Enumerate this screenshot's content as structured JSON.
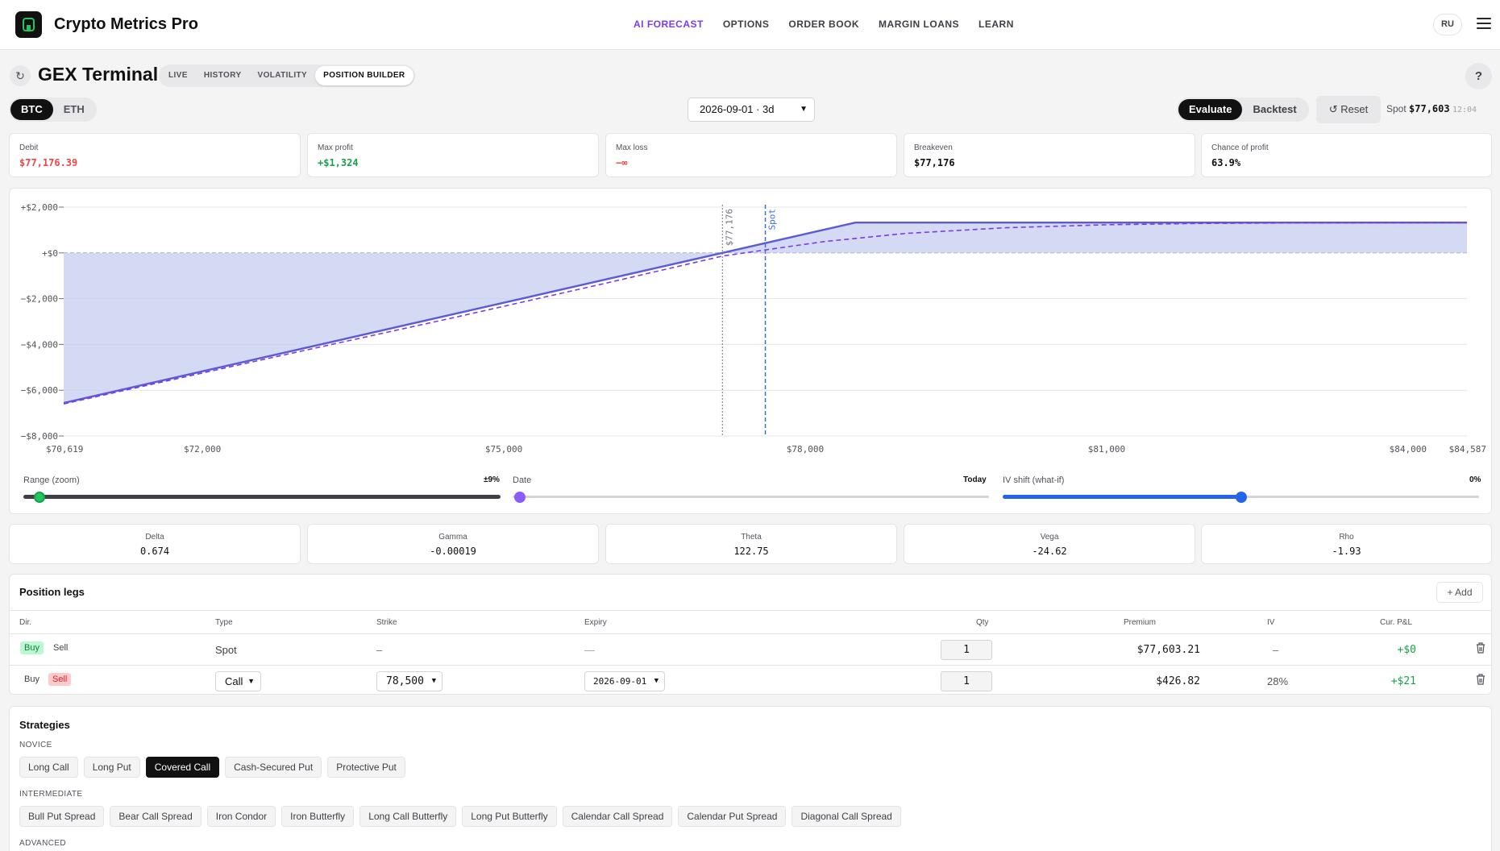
{
  "app": {
    "title": "Crypto Metrics Pro",
    "logo_icon": "chart-logo-icon"
  },
  "nav": [
    {
      "label": "AI FORECAST",
      "active": true
    },
    {
      "label": "OPTIONS",
      "active": false
    },
    {
      "label": "ORDER BOOK",
      "active": false
    },
    {
      "label": "MARGIN LOANS",
      "active": false
    },
    {
      "label": "LEARN",
      "active": false
    }
  ],
  "lang": "RU",
  "page": {
    "title": "GEX Terminal",
    "refresh_icon": "↻",
    "help_icon": "?",
    "subtabs": [
      {
        "label": "LIVE",
        "active": false
      },
      {
        "label": "HISTORY",
        "active": false
      },
      {
        "label": "VOLATILITY",
        "active": false
      },
      {
        "label": "POSITION BUILDER",
        "active": true
      }
    ]
  },
  "controls": {
    "assets": [
      {
        "label": "BTC",
        "active": true
      },
      {
        "label": "ETH",
        "active": false
      }
    ],
    "expiry": "2026-09-01 · 3d",
    "modes": [
      {
        "label": "Evaluate",
        "active": true
      },
      {
        "label": "Backtest",
        "active": false
      }
    ],
    "reset_label": "Reset",
    "spot_label": "Spot",
    "spot_value": "$77,603",
    "spot_time": "12:04"
  },
  "stats": [
    {
      "label": "Debit",
      "value": "$77,176.39",
      "tone": "red"
    },
    {
      "label": "Max profit",
      "value": "+$1,324",
      "tone": "green"
    },
    {
      "label": "Max loss",
      "value": "−∞",
      "tone": "red"
    },
    {
      "label": "Breakeven",
      "value": "$77,176",
      "tone": "dark"
    },
    {
      "label": "Chance of profit",
      "value": "63.9%",
      "tone": "dark"
    }
  ],
  "chart_data": {
    "type": "area",
    "xlim": [
      70619,
      84587
    ],
    "ylim": [
      -8000,
      2000
    ],
    "x_ticks": [
      {
        "value": 70619,
        "label": "$70,619"
      },
      {
        "value": 72000,
        "label": "$72,000"
      },
      {
        "value": 75000,
        "label": "$75,000"
      },
      {
        "value": 78000,
        "label": "$78,000"
      },
      {
        "value": 81000,
        "label": "$81,000"
      },
      {
        "value": 84000,
        "label": "$84,000"
      },
      {
        "value": 84587,
        "label": "$84,587"
      }
    ],
    "y_ticks": [
      {
        "value": 2000,
        "label": "+$2,000"
      },
      {
        "value": 0,
        "label": "+$0"
      },
      {
        "value": -2000,
        "label": "−$2,000"
      },
      {
        "value": -4000,
        "label": "−$4,000"
      },
      {
        "value": -6000,
        "label": "−$6,000"
      },
      {
        "value": -8000,
        "label": "−$8,000"
      }
    ],
    "series": [
      {
        "style": "solid",
        "color": "#5b5bd6",
        "points": [
          [
            70619,
            -6557
          ],
          [
            77176,
            0
          ],
          [
            78500,
            1324
          ],
          [
            84587,
            1324
          ]
        ]
      },
      {
        "style": "dashed",
        "color": "#7c3aed",
        "points": [
          [
            70619,
            -6600
          ],
          [
            72500,
            -4760
          ],
          [
            74500,
            -2830
          ],
          [
            76000,
            -1340
          ],
          [
            77176,
            -140
          ],
          [
            77603,
            130
          ],
          [
            78200,
            500
          ],
          [
            79000,
            850
          ],
          [
            80000,
            1100
          ],
          [
            81000,
            1230
          ],
          [
            82000,
            1290
          ],
          [
            83000,
            1310
          ],
          [
            84587,
            1320
          ]
        ]
      }
    ],
    "markers": [
      {
        "x": 77176,
        "label": "$77,176",
        "color": "#71717a",
        "style": "dotted"
      },
      {
        "x": 77603,
        "label": "Spot",
        "color": "#3b6fd6",
        "style": "dashed"
      }
    ],
    "fill_color": "#c7cdf0",
    "grid": true
  },
  "sliders": [
    {
      "label": "Range (zoom)",
      "value": "±9%",
      "fraction": 0.02
    },
    {
      "label": "Date",
      "value": "Today",
      "fraction": 0.0
    },
    {
      "label": "IV shift (what-if)",
      "value": "0%",
      "fraction": 0.5
    }
  ],
  "greeks": [
    {
      "label": "Delta",
      "value": "0.674"
    },
    {
      "label": "Gamma",
      "value": "-0.00019"
    },
    {
      "label": "Theta",
      "value": "122.75"
    },
    {
      "label": "Vega",
      "value": "-24.62"
    },
    {
      "label": "Rho",
      "value": "-1.93"
    }
  ],
  "legs": {
    "title": "Position legs",
    "add_label": "Add",
    "columns": [
      "Dir.",
      "Type",
      "Strike",
      "Expiry",
      "Qty",
      "Premium",
      "IV",
      "Cur. P&L"
    ],
    "buy_label": "Buy",
    "sell_label": "Sell",
    "rows": [
      {
        "dir": "Buy",
        "type": "Spot",
        "strike": "–",
        "expiry": "—",
        "qty": "1",
        "premium": "$77,603.21",
        "iv": "–",
        "pnl": "+$0"
      },
      {
        "dir": "Sell",
        "type": "Call",
        "strike": "78,500",
        "expiry": "2026-09-01",
        "qty": "1",
        "premium": "$426.82",
        "iv": "28%",
        "pnl": "+$21"
      }
    ]
  },
  "strategies": {
    "title": "Strategies",
    "groups": [
      {
        "label": "NOVICE",
        "items": [
          {
            "label": "Long Call",
            "active": false
          },
          {
            "label": "Long Put",
            "active": false
          },
          {
            "label": "Covered Call",
            "active": true
          },
          {
            "label": "Cash-Secured Put",
            "active": false
          },
          {
            "label": "Protective Put",
            "active": false
          }
        ]
      },
      {
        "label": "INTERMEDIATE",
        "items": [
          {
            "label": "Bull Put Spread",
            "active": false
          },
          {
            "label": "Bear Call Spread",
            "active": false
          },
          {
            "label": "Iron Condor",
            "active": false
          },
          {
            "label": "Iron Butterfly",
            "active": false
          },
          {
            "label": "Long Call Butterfly",
            "active": false
          },
          {
            "label": "Long Put Butterfly",
            "active": false
          },
          {
            "label": "Calendar Call Spread",
            "active": false
          },
          {
            "label": "Calendar Put Spread",
            "active": false
          },
          {
            "label": "Diagonal Call Spread",
            "active": false
          }
        ]
      },
      {
        "label": "ADVANCED",
        "items": []
      }
    ]
  }
}
